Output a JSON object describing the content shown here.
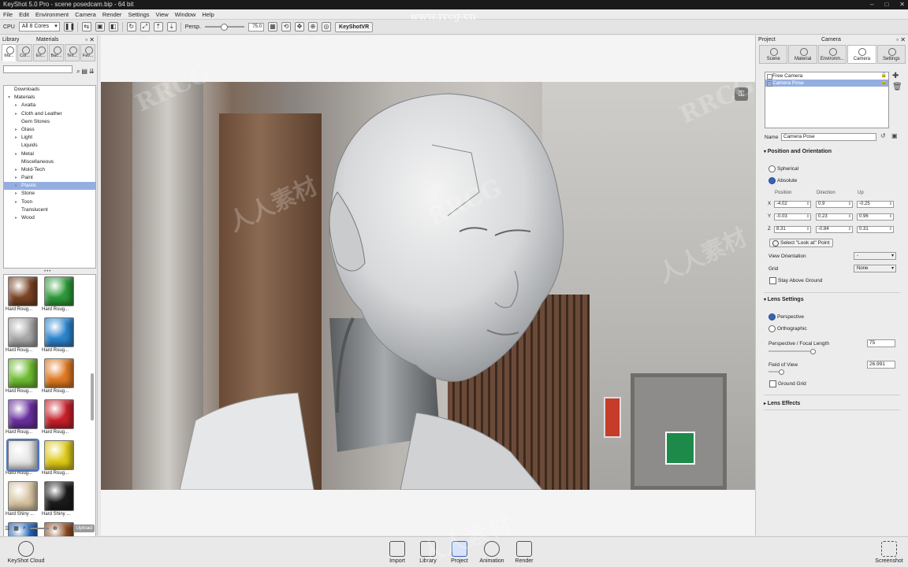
{
  "window": {
    "title": "KeyShot 5.0 Pro - scene posedcam.bip - 64 bit",
    "controls": [
      "–",
      "□",
      "✕"
    ]
  },
  "watermark": {
    "top": "www.rrcg.cn",
    "marks": [
      "RRCG",
      "人人素材",
      "RRCG",
      "人人素材",
      "RRCG",
      "人人素材"
    ]
  },
  "menu": [
    "File",
    "Edit",
    "Environment",
    "Camera",
    "Render",
    "Settings",
    "View",
    "Window",
    "Help"
  ],
  "toolbar": {
    "cpu_label": "CPU",
    "cores_value": "All 8 Cores",
    "projection_label": "Persp.",
    "fov_value": "75.0",
    "keyshotvr_label": "KeyShotVR"
  },
  "library": {
    "title": "Library",
    "section": "Materials",
    "tabs": [
      "Ma...",
      "Col...",
      "En...",
      "Bac...",
      "Tex...",
      "Fav..."
    ],
    "search_value": "",
    "tree": [
      {
        "label": "Downloads",
        "indent": 0,
        "arrow": ""
      },
      {
        "label": "Materials",
        "indent": 0,
        "arrow": "▾"
      },
      {
        "label": "Axalta",
        "indent": 1,
        "arrow": "▸"
      },
      {
        "label": "Cloth and Leather",
        "indent": 1,
        "arrow": "▸"
      },
      {
        "label": "Gem Stones",
        "indent": 1,
        "arrow": ""
      },
      {
        "label": "Glass",
        "indent": 1,
        "arrow": "▸"
      },
      {
        "label": "Light",
        "indent": 1,
        "arrow": "▸"
      },
      {
        "label": "Liquids",
        "indent": 1,
        "arrow": ""
      },
      {
        "label": "Metal",
        "indent": 1,
        "arrow": "▸"
      },
      {
        "label": "Miscellaneous",
        "indent": 1,
        "arrow": ""
      },
      {
        "label": "Mold-Tech",
        "indent": 1,
        "arrow": "▸"
      },
      {
        "label": "Paint",
        "indent": 1,
        "arrow": "▸"
      },
      {
        "label": "Plastic",
        "indent": 1,
        "arrow": "▸",
        "selected": true
      },
      {
        "label": "Stone",
        "indent": 1,
        "arrow": "▸"
      },
      {
        "label": "Toon",
        "indent": 1,
        "arrow": "▸"
      },
      {
        "label": "Translucent",
        "indent": 1,
        "arrow": ""
      },
      {
        "label": "Wood",
        "indent": 1,
        "arrow": "▸"
      }
    ],
    "swatches": [
      {
        "label": "Hard Roug...",
        "color": "#7a4426"
      },
      {
        "label": "Hard Roug...",
        "color": "#2e9a3a"
      },
      {
        "label": "Hard Roug...",
        "color": "#a9a9a9"
      },
      {
        "label": "Hard Roug...",
        "color": "#2c86d0"
      },
      {
        "label": "Hard Roug...",
        "color": "#6fbd32"
      },
      {
        "label": "Hard Roug...",
        "color": "#e07a21"
      },
      {
        "label": "Hard Roug...",
        "color": "#6a2fa0"
      },
      {
        "label": "Hard Roug...",
        "color": "#c8202a"
      },
      {
        "label": "Hard Roug...",
        "color": "#e8e8e8",
        "selected": true
      },
      {
        "label": "Hard Roug...",
        "color": "#e0cc1c"
      },
      {
        "label": "Hard Shiny ...",
        "color": "#d9c6a4"
      },
      {
        "label": "Hard Shiny ...",
        "color": "#1b1b1b"
      },
      {
        "label": "",
        "color": "#1f63b8"
      },
      {
        "label": "",
        "color": "#8a4a22"
      }
    ],
    "upload_label": "Upload"
  },
  "project": {
    "title": "Project",
    "section": "Camera",
    "tabs": [
      "Scene",
      "Material",
      "Environm...",
      "Camera",
      "Settings"
    ],
    "active_tab": "Camera",
    "cameras": [
      {
        "label": "Free Camera",
        "selected": false
      },
      {
        "label": "Camera Pose",
        "selected": true
      }
    ],
    "name_label": "Name",
    "name_value": "Camera Pose",
    "position_section": "Position and Orientation",
    "spherical_label": "Spherical",
    "absolute_label": "Absolute",
    "col_position": "Position",
    "col_direction": "Direction",
    "col_up": "Up",
    "rows": [
      {
        "axis": "X",
        "position": "-4.02",
        "direction": "0.9",
        "up": "-0.25"
      },
      {
        "axis": "Y",
        "position": "-0.03",
        "direction": "0.23",
        "up": "0.96"
      },
      {
        "axis": "Z",
        "position": "8.31",
        "direction": "-0.84",
        "up": "0.31"
      }
    ],
    "lookat_label": "Select \"Look at\" Point",
    "view_orientation_label": "View Orientation",
    "view_orientation_value": "-",
    "grid_label": "Grid",
    "grid_value": "None",
    "stay_above_label": "Stay Above Ground",
    "lens_section": "Lens Settings",
    "perspective_label": "Perspective",
    "orthographic_label": "Orthographic",
    "focal_label": "Perspective / Focal Length",
    "focal_value": "75",
    "fov_label": "Field of View",
    "fov_value": "26.991",
    "ground_grid_label": "Ground Grid",
    "lens_effects_section": "Lens Effects"
  },
  "bottom": {
    "cloud_label": "KeyShot Cloud",
    "import_label": "Import",
    "library_label": "Library",
    "project_label": "Project",
    "animation_label": "Animation",
    "render_label": "Render",
    "screenshot_label": "Screenshot"
  },
  "colors": {
    "accent": "#3763b3",
    "selection": "#95aee0"
  }
}
